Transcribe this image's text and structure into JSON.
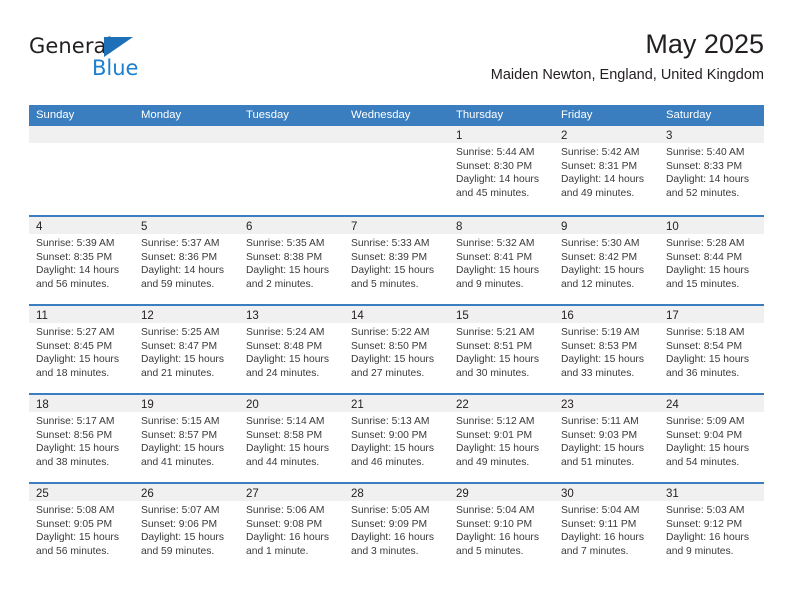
{
  "brand": {
    "name_top": "General",
    "name_bottom": "Blue",
    "accent_color": "#1d7fd0"
  },
  "header": {
    "title": "May 2025",
    "location": "Maiden Newton, England, United Kingdom"
  },
  "theme": {
    "header_blue": "#3a7ebf",
    "day_strip_gray": "#f0f0f0"
  },
  "weekdays": [
    "Sunday",
    "Monday",
    "Tuesday",
    "Wednesday",
    "Thursday",
    "Friday",
    "Saturday"
  ],
  "weeks": [
    [
      {
        "day": "",
        "sunrise": "",
        "sunset": "",
        "daylight": "",
        "empty": true
      },
      {
        "day": "",
        "sunrise": "",
        "sunset": "",
        "daylight": "",
        "empty": true
      },
      {
        "day": "",
        "sunrise": "",
        "sunset": "",
        "daylight": "",
        "empty": true
      },
      {
        "day": "",
        "sunrise": "",
        "sunset": "",
        "daylight": "",
        "empty": true
      },
      {
        "day": "1",
        "sunrise": "Sunrise: 5:44 AM",
        "sunset": "Sunset: 8:30 PM",
        "daylight": "Daylight: 14 hours and 45 minutes."
      },
      {
        "day": "2",
        "sunrise": "Sunrise: 5:42 AM",
        "sunset": "Sunset: 8:31 PM",
        "daylight": "Daylight: 14 hours and 49 minutes."
      },
      {
        "day": "3",
        "sunrise": "Sunrise: 5:40 AM",
        "sunset": "Sunset: 8:33 PM",
        "daylight": "Daylight: 14 hours and 52 minutes."
      }
    ],
    [
      {
        "day": "4",
        "sunrise": "Sunrise: 5:39 AM",
        "sunset": "Sunset: 8:35 PM",
        "daylight": "Daylight: 14 hours and 56 minutes."
      },
      {
        "day": "5",
        "sunrise": "Sunrise: 5:37 AM",
        "sunset": "Sunset: 8:36 PM",
        "daylight": "Daylight: 14 hours and 59 minutes."
      },
      {
        "day": "6",
        "sunrise": "Sunrise: 5:35 AM",
        "sunset": "Sunset: 8:38 PM",
        "daylight": "Daylight: 15 hours and 2 minutes."
      },
      {
        "day": "7",
        "sunrise": "Sunrise: 5:33 AM",
        "sunset": "Sunset: 8:39 PM",
        "daylight": "Daylight: 15 hours and 5 minutes."
      },
      {
        "day": "8",
        "sunrise": "Sunrise: 5:32 AM",
        "sunset": "Sunset: 8:41 PM",
        "daylight": "Daylight: 15 hours and 9 minutes."
      },
      {
        "day": "9",
        "sunrise": "Sunrise: 5:30 AM",
        "sunset": "Sunset: 8:42 PM",
        "daylight": "Daylight: 15 hours and 12 minutes."
      },
      {
        "day": "10",
        "sunrise": "Sunrise: 5:28 AM",
        "sunset": "Sunset: 8:44 PM",
        "daylight": "Daylight: 15 hours and 15 minutes."
      }
    ],
    [
      {
        "day": "11",
        "sunrise": "Sunrise: 5:27 AM",
        "sunset": "Sunset: 8:45 PM",
        "daylight": "Daylight: 15 hours and 18 minutes."
      },
      {
        "day": "12",
        "sunrise": "Sunrise: 5:25 AM",
        "sunset": "Sunset: 8:47 PM",
        "daylight": "Daylight: 15 hours and 21 minutes."
      },
      {
        "day": "13",
        "sunrise": "Sunrise: 5:24 AM",
        "sunset": "Sunset: 8:48 PM",
        "daylight": "Daylight: 15 hours and 24 minutes."
      },
      {
        "day": "14",
        "sunrise": "Sunrise: 5:22 AM",
        "sunset": "Sunset: 8:50 PM",
        "daylight": "Daylight: 15 hours and 27 minutes."
      },
      {
        "day": "15",
        "sunrise": "Sunrise: 5:21 AM",
        "sunset": "Sunset: 8:51 PM",
        "daylight": "Daylight: 15 hours and 30 minutes."
      },
      {
        "day": "16",
        "sunrise": "Sunrise: 5:19 AM",
        "sunset": "Sunset: 8:53 PM",
        "daylight": "Daylight: 15 hours and 33 minutes."
      },
      {
        "day": "17",
        "sunrise": "Sunrise: 5:18 AM",
        "sunset": "Sunset: 8:54 PM",
        "daylight": "Daylight: 15 hours and 36 minutes."
      }
    ],
    [
      {
        "day": "18",
        "sunrise": "Sunrise: 5:17 AM",
        "sunset": "Sunset: 8:56 PM",
        "daylight": "Daylight: 15 hours and 38 minutes."
      },
      {
        "day": "19",
        "sunrise": "Sunrise: 5:15 AM",
        "sunset": "Sunset: 8:57 PM",
        "daylight": "Daylight: 15 hours and 41 minutes."
      },
      {
        "day": "20",
        "sunrise": "Sunrise: 5:14 AM",
        "sunset": "Sunset: 8:58 PM",
        "daylight": "Daylight: 15 hours and 44 minutes."
      },
      {
        "day": "21",
        "sunrise": "Sunrise: 5:13 AM",
        "sunset": "Sunset: 9:00 PM",
        "daylight": "Daylight: 15 hours and 46 minutes."
      },
      {
        "day": "22",
        "sunrise": "Sunrise: 5:12 AM",
        "sunset": "Sunset: 9:01 PM",
        "daylight": "Daylight: 15 hours and 49 minutes."
      },
      {
        "day": "23",
        "sunrise": "Sunrise: 5:11 AM",
        "sunset": "Sunset: 9:03 PM",
        "daylight": "Daylight: 15 hours and 51 minutes."
      },
      {
        "day": "24",
        "sunrise": "Sunrise: 5:09 AM",
        "sunset": "Sunset: 9:04 PM",
        "daylight": "Daylight: 15 hours and 54 minutes."
      }
    ],
    [
      {
        "day": "25",
        "sunrise": "Sunrise: 5:08 AM",
        "sunset": "Sunset: 9:05 PM",
        "daylight": "Daylight: 15 hours and 56 minutes."
      },
      {
        "day": "26",
        "sunrise": "Sunrise: 5:07 AM",
        "sunset": "Sunset: 9:06 PM",
        "daylight": "Daylight: 15 hours and 59 minutes."
      },
      {
        "day": "27",
        "sunrise": "Sunrise: 5:06 AM",
        "sunset": "Sunset: 9:08 PM",
        "daylight": "Daylight: 16 hours and 1 minute."
      },
      {
        "day": "28",
        "sunrise": "Sunrise: 5:05 AM",
        "sunset": "Sunset: 9:09 PM",
        "daylight": "Daylight: 16 hours and 3 minutes."
      },
      {
        "day": "29",
        "sunrise": "Sunrise: 5:04 AM",
        "sunset": "Sunset: 9:10 PM",
        "daylight": "Daylight: 16 hours and 5 minutes."
      },
      {
        "day": "30",
        "sunrise": "Sunrise: 5:04 AM",
        "sunset": "Sunset: 9:11 PM",
        "daylight": "Daylight: 16 hours and 7 minutes."
      },
      {
        "day": "31",
        "sunrise": "Sunrise: 5:03 AM",
        "sunset": "Sunset: 9:12 PM",
        "daylight": "Daylight: 16 hours and 9 minutes."
      }
    ]
  ]
}
